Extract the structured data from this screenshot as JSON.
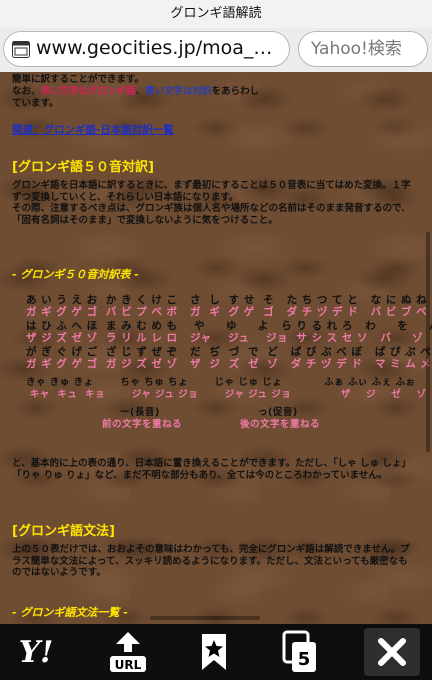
{
  "window_title": "グロンギ語解読",
  "url": "www.geocities.jp/moa_…",
  "search_placeholder": "Yahoo!検索",
  "intro": {
    "line1": "簡単に訳することができます。",
    "line2a": "なお、",
    "red_part": "赤い文字はグロンギ語",
    "line2b": "、",
    "blue_part": "青い文字は対訳",
    "line2c": "をあらわし",
    "line3": "ています。"
  },
  "link": "関連：グロンギ語-日本語対訳一覧",
  "section1": {
    "heading": "[グロンギ語５０音対訳]",
    "para": "グロンギ語を日本語に訳するときに、まず最初にすることは５０音表に当てはめた変換。１字ずつ変換していくと、それらしい日本語になります。\nその際、注意するべき点は、グロンギ族は個人名や場所などの名前はそのまま発音するので、「固有名詞はそのまま」で変換しないように気をつけること。"
  },
  "table_title": "- グロンギ５０音対訳表 -",
  "kana_rows": [
    {
      "text": "あ い う え お  か き く け こ   さ  し  す せ  そ   た ち つ て と   な に ぬ ね の",
      "style": "black"
    },
    {
      "text": "ガ ギ グ ゲ ゴ  バ ビ プ ベ ボ   ガ  ギ  グ ゲ  ゴ   ダ チ ヅ デ ド   バ ビ ブ ベ ボ",
      "style": "pink"
    },
    {
      "text": "は ひ ふ へ ほ  ま み む め も    や     ゆ     よ   ら り る れ ろ   わ     を     ん",
      "style": "black"
    },
    {
      "text": "ザ ジ ズ ゼ ゾ  ラ リ ル レ ロ   ジャ    ジュ    ジョ  サ シ ス セ ソ   バ     ゾ     ン",
      "style": "pink"
    },
    {
      "text": "が ぎ ぐ げ ご  ざ じ ず ぜ ぞ   だ  ぢ  づ  で  ど   ば び ぶ べ ぼ   ぱ ぴ ぷ ぺ ぽ",
      "style": "black"
    },
    {
      "text": "ガ ギ グ ゲ ゴ  ガ ジ ズ ゼ ゾ   ザ  ジ  ズ  ゼ  ゾ   ダ チ ヅ デ ド   マ ミ ム メ モ",
      "style": "pink"
    }
  ],
  "small_rows": [
    {
      "text": "きゃ きゅ きょ       ちゃ ちゅ ちょ       じゃ じゅ じょ           ふぁ ふぃ ふぇ ふぉ",
      "style": "black"
    },
    {
      "text": " キャ  キュ  キョ       ジャ ジュ ジョ       ジャ ジュ ジョ             ザ    ジ    ゼ    ゾ",
      "style": "pink"
    }
  ],
  "notes": [
    {
      "label": "ー(長音)",
      "desc": "前の文字を重ねる"
    },
    {
      "label": "っ(促音)",
      "desc": "後の文字を重ねる"
    }
  ],
  "para2": "と、基本的に上の表の通り、日本語に置き換えることができます。ただし、「しゃ しゅ しょ」「りゃ りゅ りょ」など、まだ不明な部分もあり、全ては今のところわかっていません。",
  "section2": {
    "heading": "[グロンギ語文法]",
    "para": "上の５０表だけでは、おおよその意味はわかっても、完全にグロンギ語は解読できません。プラス簡単な文法によって、スッキリ読めるようになります。ただし、文法といっても厳密なものではないようです。"
  },
  "footer_title": "- グロンギ語文法一覧 -",
  "toolbar": {
    "yahoo": "Y!",
    "url": "URL",
    "tabs": "5"
  }
}
